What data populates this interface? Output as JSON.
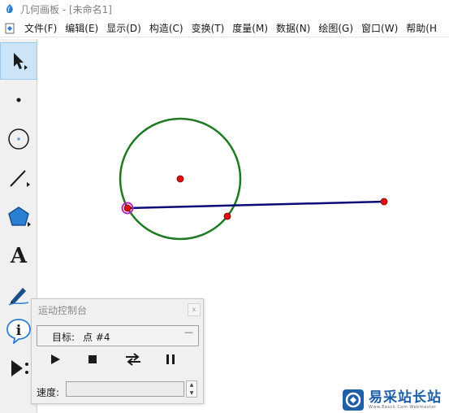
{
  "window": {
    "title": "几何画板 - [未命名1]"
  },
  "menubar": {
    "items": [
      {
        "label": "文件(F)"
      },
      {
        "label": "编辑(E)"
      },
      {
        "label": "显示(D)"
      },
      {
        "label": "构造(C)"
      },
      {
        "label": "变换(T)"
      },
      {
        "label": "度量(M)"
      },
      {
        "label": "数据(N)"
      },
      {
        "label": "绘图(G)"
      },
      {
        "label": "窗口(W)"
      },
      {
        "label": "帮助(H"
      }
    ]
  },
  "toolbox": {
    "tools": [
      {
        "name": "arrow-select-tool",
        "icon": "arrow-icon",
        "active": true
      },
      {
        "name": "point-tool",
        "icon": "point-icon",
        "active": false
      },
      {
        "name": "compass-tool",
        "icon": "circle-icon",
        "active": false
      },
      {
        "name": "straightedge-tool",
        "icon": "line-segment-icon",
        "active": false
      },
      {
        "name": "polygon-tool",
        "icon": "pentagon-icon",
        "active": false
      },
      {
        "name": "text-tool",
        "icon": "text-a-icon",
        "active": false
      },
      {
        "name": "marker-tool",
        "icon": "pen-icon",
        "active": false
      },
      {
        "name": "information-tool",
        "icon": "info-icon",
        "active": false
      },
      {
        "name": "custom-tool",
        "icon": "custom-tool-icon",
        "active": false
      }
    ],
    "text_tool_glyph": "A",
    "info_tool_glyph": "i"
  },
  "colors": {
    "circle": "#1e7a1e",
    "segment": "#0a0a7a",
    "point": "#e01010",
    "selected_point_ring": "#c020c0",
    "active_tool_bg": "#cce4f7",
    "watermark_blue": "#1f5fa8"
  },
  "motion_panel": {
    "title": "运动控制台",
    "close_glyph": "x",
    "target_label": "目标:",
    "target_value": "点 #4",
    "target_dropdown_glyph": "—",
    "buttons": [
      {
        "name": "play-button",
        "icon": "play-icon"
      },
      {
        "name": "stop-button",
        "icon": "stop-icon"
      },
      {
        "name": "reverse-button",
        "icon": "reverse-arrows-icon"
      },
      {
        "name": "pause-button",
        "icon": "pause-icon"
      }
    ],
    "speed_label": "速度:",
    "speed_value": ""
  },
  "watermark": {
    "main": "易采站长站",
    "sub": "Www.Easck.Com  Webmaster"
  }
}
